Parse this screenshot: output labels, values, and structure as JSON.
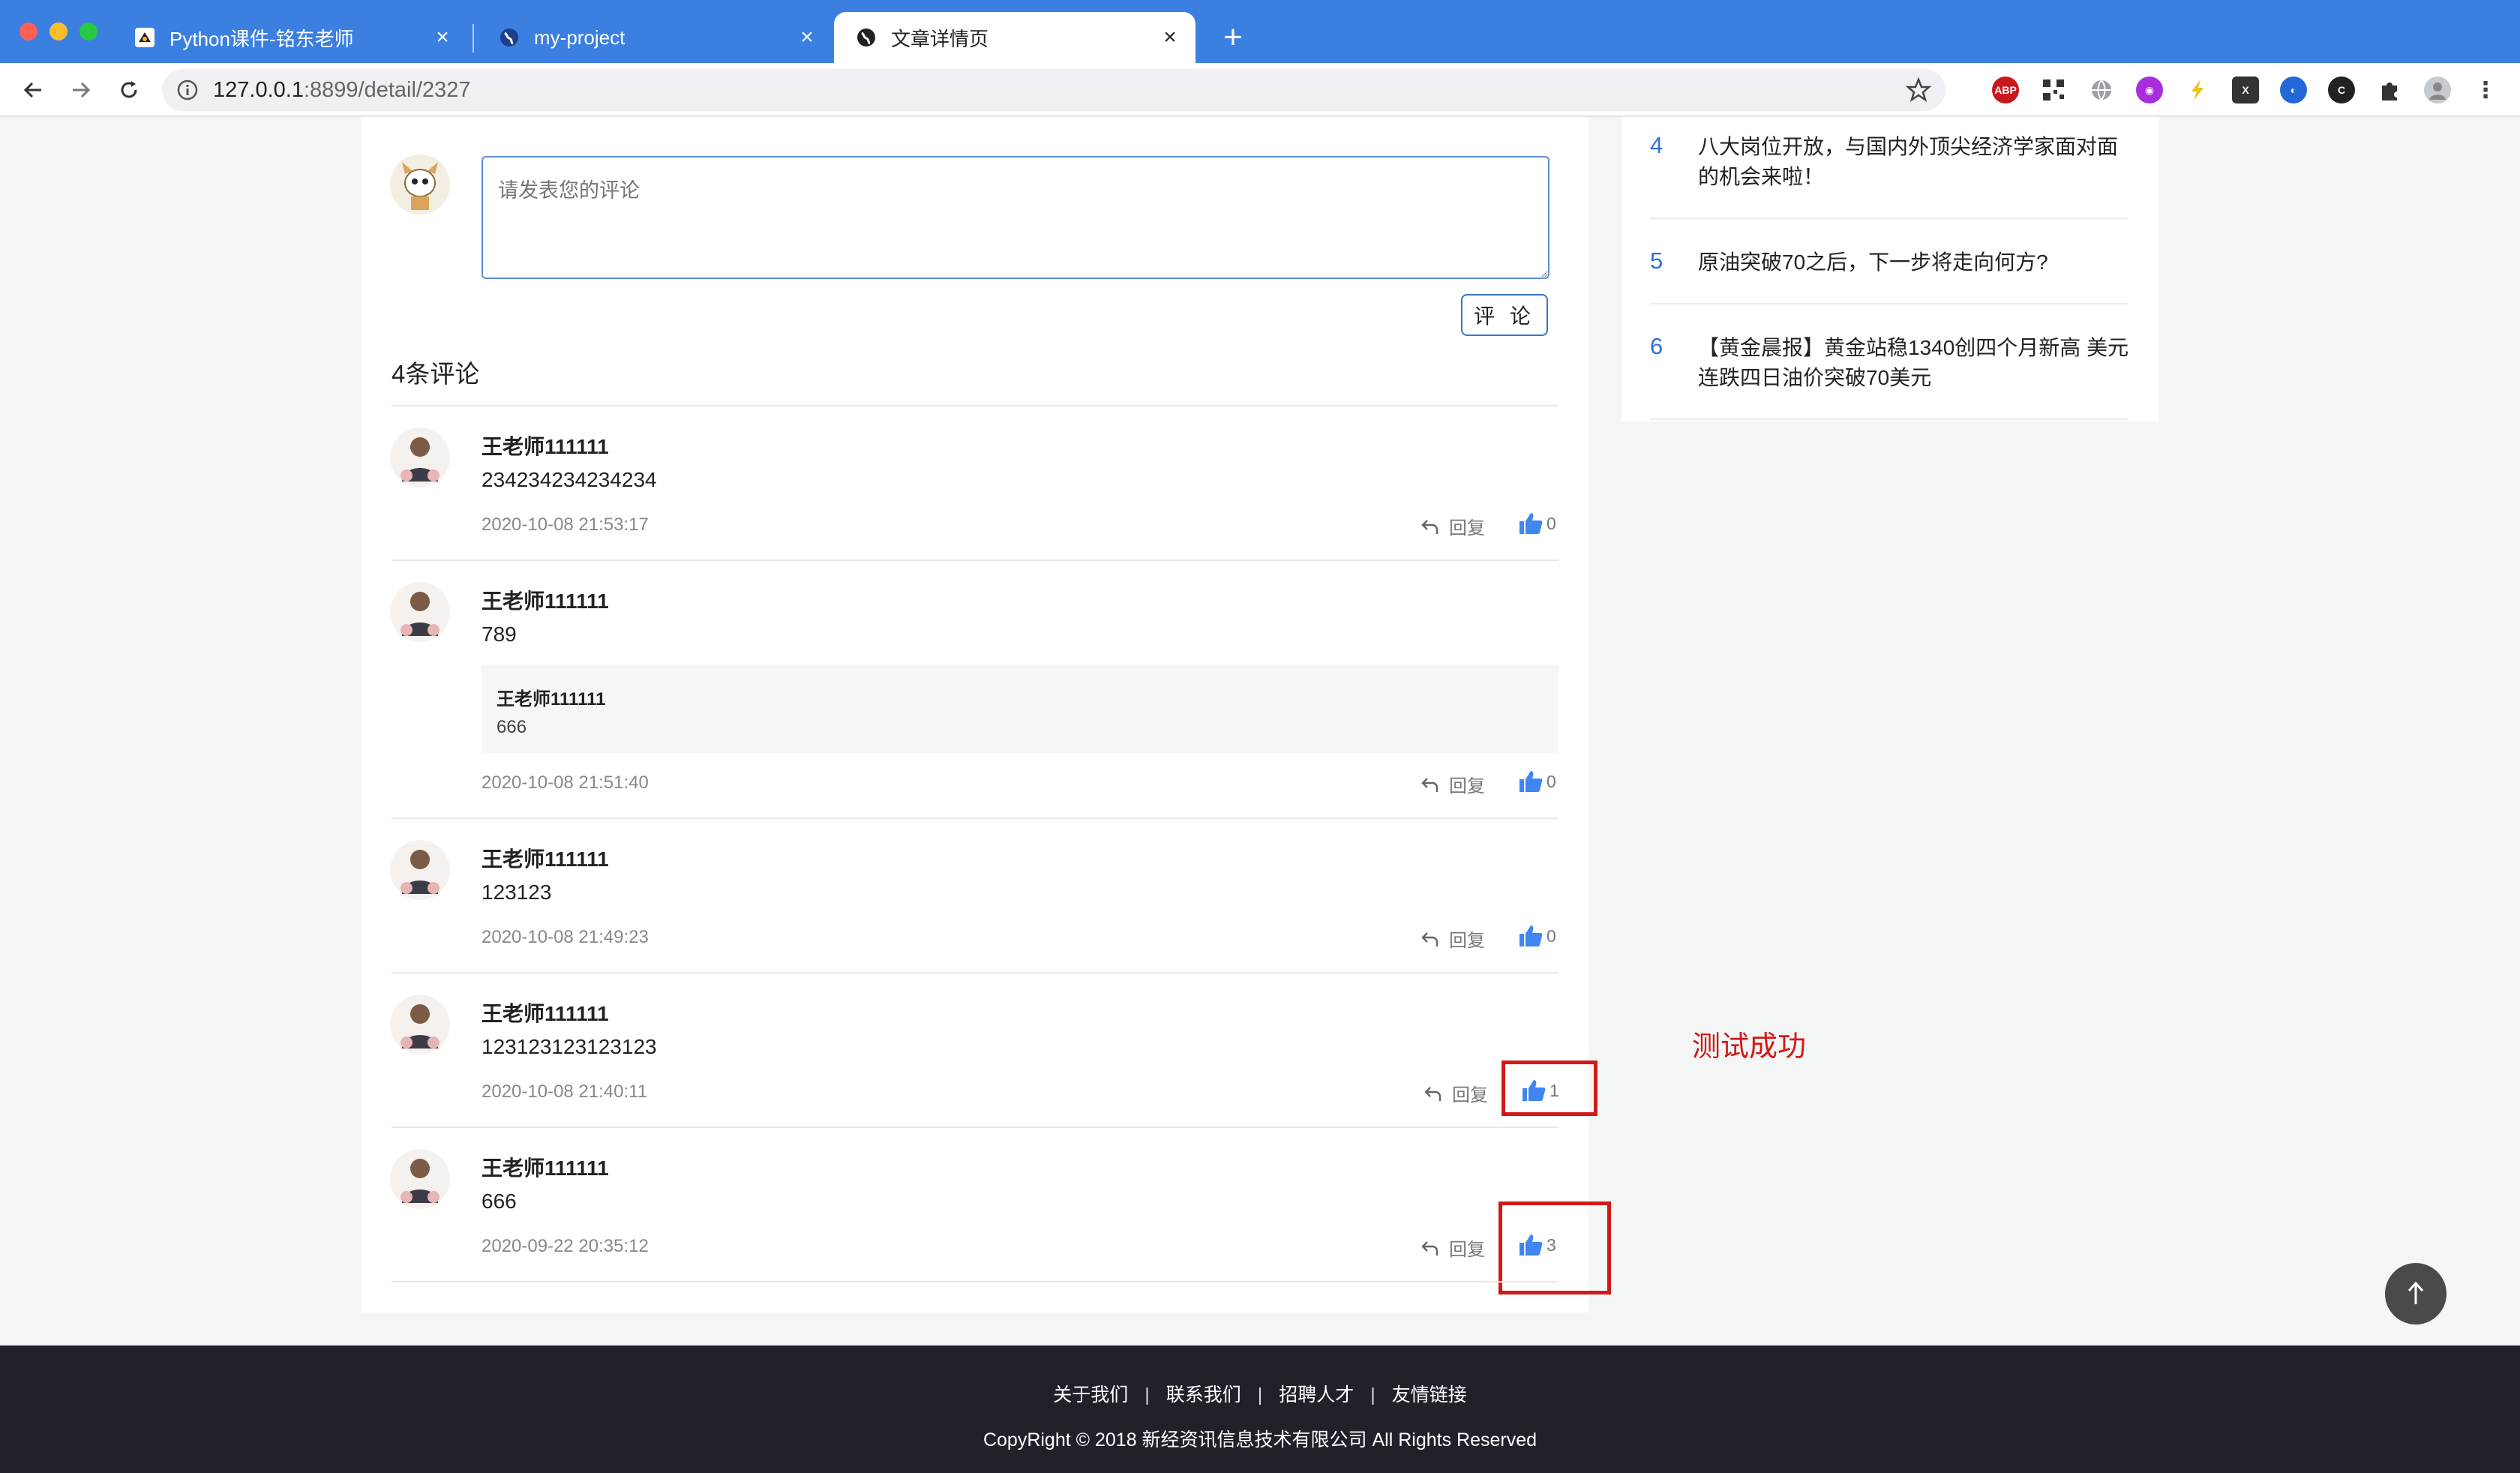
{
  "browser": {
    "tabs": [
      {
        "title": "Python课件-铭东老师"
      },
      {
        "title": "my-project"
      },
      {
        "title": "文章详情页"
      }
    ],
    "url_host": "127.0.0.1",
    "url_rest": ":8899/detail/2327"
  },
  "comment_form": {
    "placeholder": "请发表您的评论",
    "submit_label": "评 论"
  },
  "comments_section": {
    "count_title": "4条评论",
    "reply_label": "回复",
    "comments": [
      {
        "author": "王老师111111",
        "text": "234234234234234",
        "time": "2020-10-08 21:53:17",
        "likes": "0"
      },
      {
        "author": "王老师111111",
        "text": "789",
        "time": "2020-10-08 21:51:40",
        "likes": "0",
        "reply": {
          "author": "王老师111111",
          "text": "666"
        }
      },
      {
        "author": "王老师111111",
        "text": "123123",
        "time": "2020-10-08 21:49:23",
        "likes": "0"
      },
      {
        "author": "王老师111111",
        "text": "123123123123123",
        "time": "2020-10-08 21:40:11",
        "likes": "1"
      },
      {
        "author": "王老师111111",
        "text": "666",
        "time": "2020-09-22 20:35:12",
        "likes": "3"
      }
    ]
  },
  "annotation": {
    "text": "测试成功",
    "color": "#d21818"
  },
  "sidebar": {
    "items": [
      {
        "num": "4",
        "title": "八大岗位开放，与国内外顶尖经济学家面对面的机会来啦！"
      },
      {
        "num": "5",
        "title": "原油突破70之后，下一步将走向何方?"
      },
      {
        "num": "6",
        "title": "【黄金晨报】黄金站稳1340创四个月新高 美元连跌四日油价突破70美元"
      }
    ]
  },
  "footer": {
    "links": [
      "关于我们",
      "联系我们",
      "招聘人才",
      "友情链接"
    ],
    "separator": "|",
    "copyright": "CopyRight © 2018 新经资讯信息技术有限公司 All Rights Reserved"
  },
  "colors": {
    "tabbar": "#3b80e0",
    "accent_blue": "#2f6fd6",
    "like_blue": "#3f86f0",
    "footer_bg": "#1f2329"
  }
}
